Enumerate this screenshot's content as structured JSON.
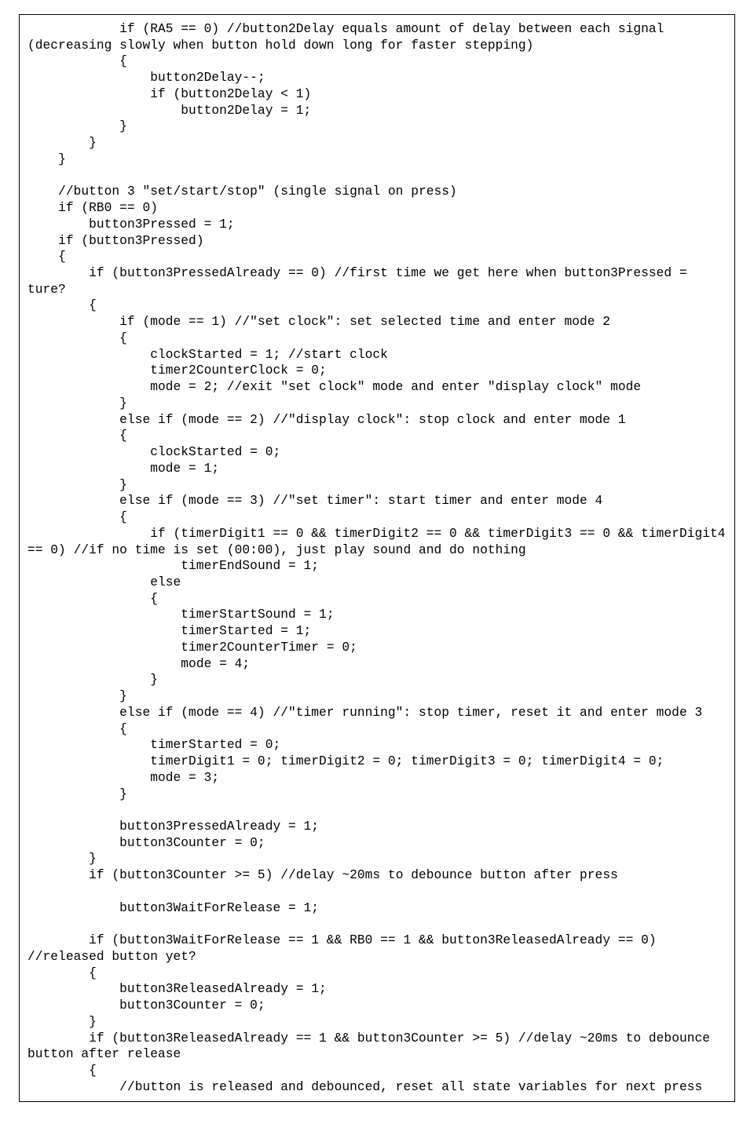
{
  "code": {
    "lines": [
      "            if (RA5 == 0) //button2Delay equals amount of delay between each signal (decreasing slowly when button hold down long for faster stepping)",
      "            {",
      "                button2Delay--;",
      "                if (button2Delay < 1)",
      "                    button2Delay = 1;",
      "            }",
      "        }",
      "    }",
      "",
      "    //button 3 \"set/start/stop\" (single signal on press)",
      "    if (RB0 == 0)",
      "        button3Pressed = 1;",
      "    if (button3Pressed)",
      "    {",
      "        if (button3PressedAlready == 0) //first time we get here when button3Pressed = ture?",
      "        {",
      "            if (mode == 1) //\"set clock\": set selected time and enter mode 2",
      "            {",
      "                clockStarted = 1; //start clock",
      "                timer2CounterClock = 0;",
      "                mode = 2; //exit \"set clock\" mode and enter \"display clock\" mode",
      "            }",
      "            else if (mode == 2) //\"display clock\": stop clock and enter mode 1",
      "            {",
      "                clockStarted = 0;",
      "                mode = 1;",
      "            }",
      "            else if (mode == 3) //\"set timer\": start timer and enter mode 4",
      "            {",
      "                if (timerDigit1 == 0 && timerDigit2 == 0 && timerDigit3 == 0 && timerDigit4 == 0) //if no time is set (00:00), just play sound and do nothing",
      "                    timerEndSound = 1;",
      "                else",
      "                {",
      "                    timerStartSound = 1;",
      "                    timerStarted = 1;",
      "                    timer2CounterTimer = 0;",
      "                    mode = 4;",
      "                }",
      "            }",
      "            else if (mode == 4) //\"timer running\": stop timer, reset it and enter mode 3",
      "            {",
      "                timerStarted = 0;",
      "                timerDigit1 = 0; timerDigit2 = 0; timerDigit3 = 0; timerDigit4 = 0;",
      "                mode = 3;",
      "            }",
      "",
      "            button3PressedAlready = 1;",
      "            button3Counter = 0;",
      "        }",
      "        if (button3Counter >= 5) //delay ~20ms to debounce button after press",
      "",
      "            button3WaitForRelease = 1;",
      "",
      "        if (button3WaitForRelease == 1 && RB0 == 1 && button3ReleasedAlready == 0) //released button yet?",
      "        {",
      "            button3ReleasedAlready = 1;",
      "            button3Counter = 0;",
      "        }",
      "        if (button3ReleasedAlready == 1 && button3Counter >= 5) //delay ~20ms to debounce button after release",
      "        {",
      "            //button is released and debounced, reset all state variables for next press"
    ]
  }
}
